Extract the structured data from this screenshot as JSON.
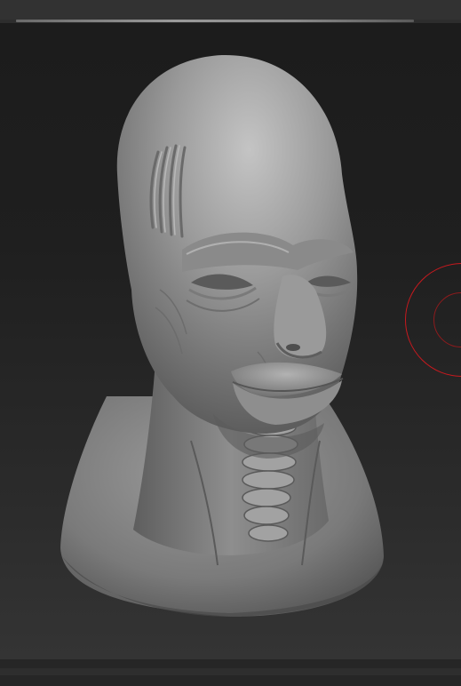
{
  "app": {
    "background_color": "#2d2d2d",
    "viewport_top_color": "#1c1c1c",
    "viewport_bottom_color": "#343434"
  },
  "scene": {
    "object": "sculpted-head-bust",
    "material_color": "#8c8c8c"
  },
  "brush": {
    "cursor_color": "#c8191e",
    "shape": "draw-size-ring"
  }
}
